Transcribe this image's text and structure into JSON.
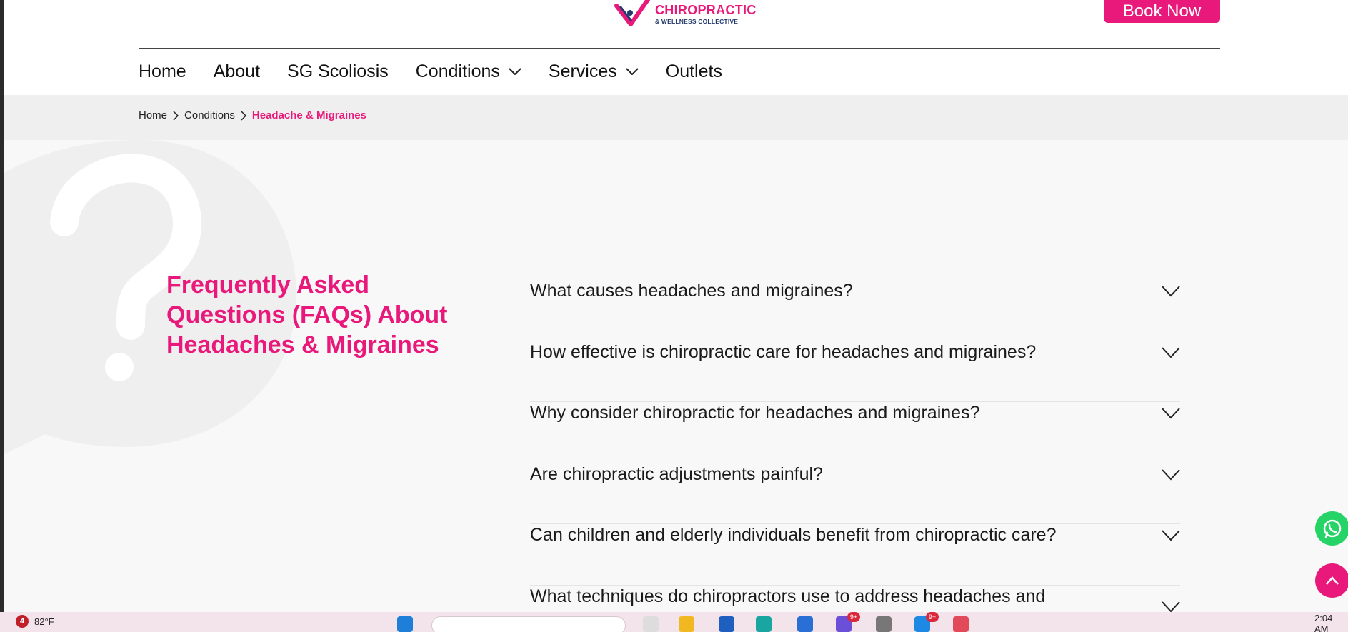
{
  "brand": {
    "logo_title": "CHIROPRACTIC",
    "logo_subtitle": "& WELLNESS COLLECTIVE",
    "logo_top_partial": "TRUE",
    "accent_color": "#e8197a",
    "navy_color": "#243a6e"
  },
  "header": {
    "book_button": "Book Now"
  },
  "nav": {
    "items": [
      {
        "label": "Home",
        "has_dropdown": false
      },
      {
        "label": "About",
        "has_dropdown": false
      },
      {
        "label": "SG Scoliosis",
        "has_dropdown": false
      },
      {
        "label": "Conditions",
        "has_dropdown": true
      },
      {
        "label": "Services",
        "has_dropdown": true
      },
      {
        "label": "Outlets",
        "has_dropdown": false
      }
    ]
  },
  "breadcrumb": {
    "items": [
      "Home",
      "Conditions"
    ],
    "current": "Headache & Migraines"
  },
  "faq": {
    "heading": "Frequently Asked Questions (FAQs) About Headaches & Migraines",
    "questions": [
      "What causes headaches and migraines?",
      "How effective is chiropractic care for headaches and migraines?",
      "Why consider chiropractic for headaches and migraines?",
      "Are chiropractic adjustments painful?",
      "Can children and elderly individuals benefit from chiropractic care?",
      "What techniques do chiropractors use to address headaches and"
    ]
  },
  "floating": {
    "whatsapp_icon": "whatsapp-icon",
    "back_to_top_icon": "chevron-up-icon"
  },
  "taskbar": {
    "weather_badge": "4",
    "temperature": "82°F",
    "notif_badge_1": "9+",
    "notif_badge_2": "9+",
    "clock": "2:04 AM"
  }
}
